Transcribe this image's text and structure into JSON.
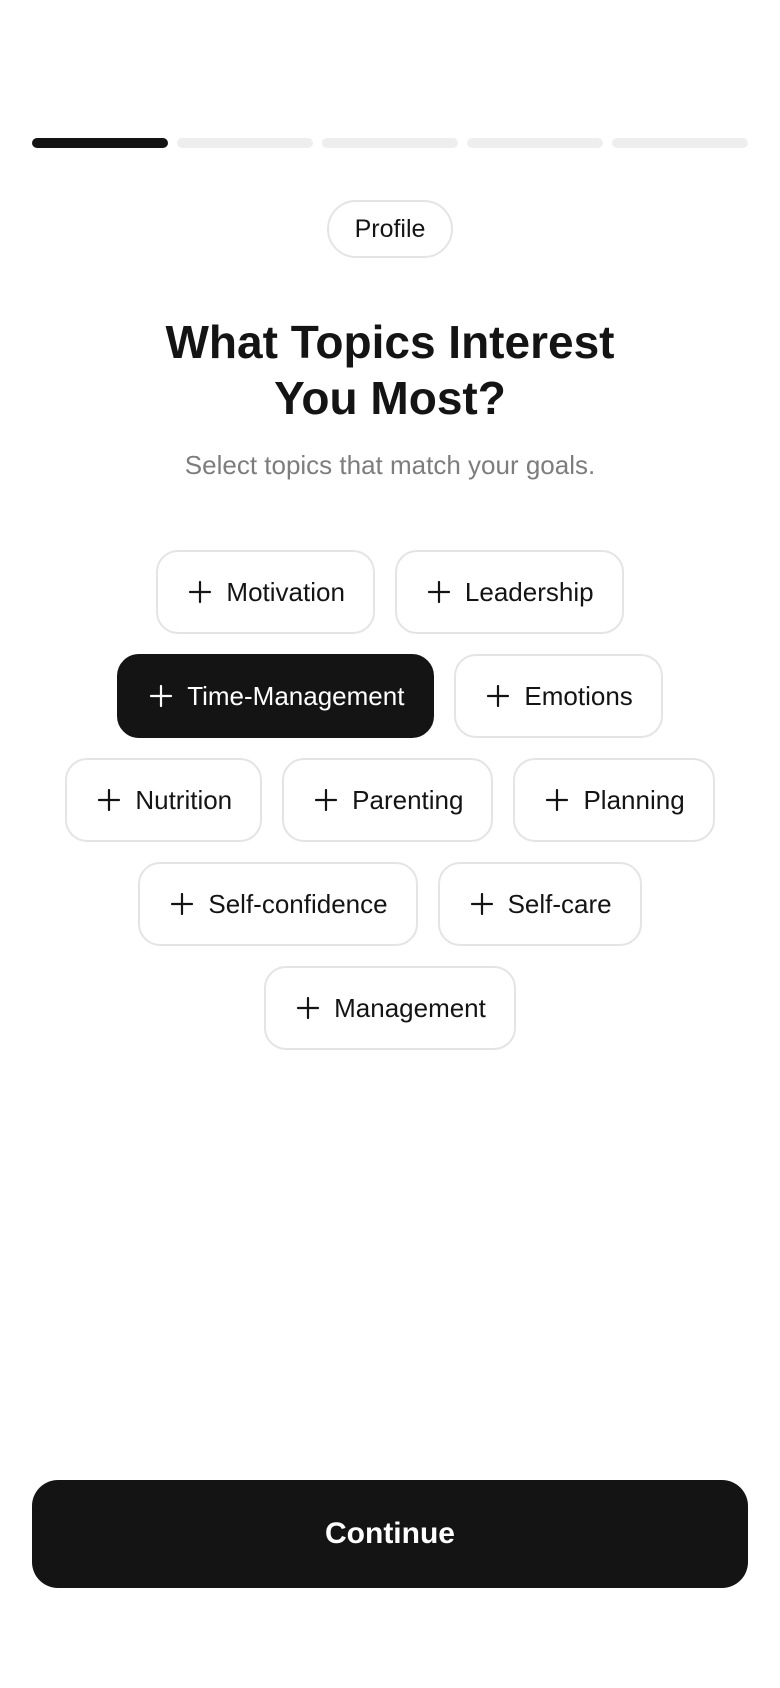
{
  "progress": {
    "total_steps": 5,
    "current_step": 1
  },
  "step_badge": "Profile",
  "heading": {
    "line1": "What Topics Interest",
    "line2": "You Most?"
  },
  "subtitle": "Select topics that match your goals.",
  "topics": [
    {
      "label": "Motivation",
      "selected": false
    },
    {
      "label": "Leadership",
      "selected": false
    },
    {
      "label": "Time-Management",
      "selected": true
    },
    {
      "label": "Emotions",
      "selected": false
    },
    {
      "label": "Nutrition",
      "selected": false
    },
    {
      "label": "Parenting",
      "selected": false
    },
    {
      "label": "Planning",
      "selected": false
    },
    {
      "label": "Self-confidence",
      "selected": false
    },
    {
      "label": "Self-care",
      "selected": false
    },
    {
      "label": "Management",
      "selected": false
    }
  ],
  "icons": {
    "chip_icon": "plus-icon"
  },
  "colors": {
    "accent": "#141414",
    "inactive_progress": "#eeeeee",
    "chip_border": "#e4e4e4",
    "subtitle": "#7d7d7d"
  },
  "continue_label": "Continue"
}
